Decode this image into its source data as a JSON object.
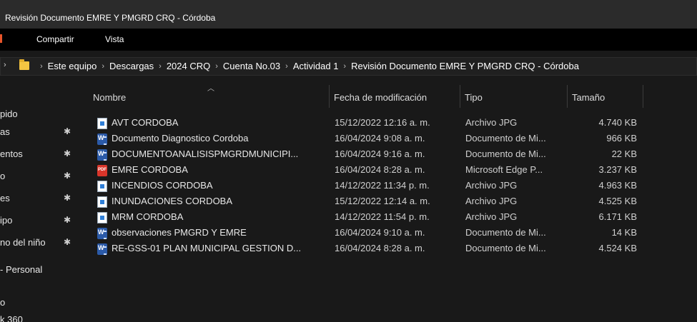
{
  "window": {
    "title": "Revisión Documento EMRE Y PMGRD CRQ - Córdoba"
  },
  "ribbon": {
    "tabs": [
      "Compartir",
      "Vista"
    ]
  },
  "address": {
    "back_glyph": "›",
    "crumbs": [
      "Este equipo",
      "Descargas",
      "2024 CRQ",
      "Cuenta No.03",
      "Actividad 1",
      "Revisión Documento EMRE Y PMGRD CRQ - Córdoba"
    ]
  },
  "nav": {
    "items": [
      {
        "label": "pido",
        "pinned": false
      },
      {
        "label": "as",
        "pinned": true
      },
      {
        "label": "entos",
        "pinned": true
      },
      {
        "label": "o",
        "pinned": true
      },
      {
        "label": "es",
        "pinned": true
      },
      {
        "label": "ipo",
        "pinned": true
      },
      {
        "label": "no del niño",
        "pinned": true
      },
      {
        "label": "- Personal",
        "pinned": false
      },
      {
        "label": "o",
        "pinned": false
      },
      {
        "label": "k 360",
        "pinned": false
      }
    ]
  },
  "columns": {
    "name": "Nombre",
    "date": "Fecha de modificación",
    "type": "Tipo",
    "size": "Tamaño"
  },
  "files": [
    {
      "icon": "jpg-file-icon",
      "name": "AVT CORDOBA",
      "date": "15/12/2022 12:16 a. m.",
      "type": "Archivo JPG",
      "size": "4.740 KB"
    },
    {
      "icon": "word-file-icon",
      "name": "Documento Diagnostico Cordoba",
      "date": "16/04/2024 9:08 a. m.",
      "type": "Documento de Mi...",
      "size": "966 KB"
    },
    {
      "icon": "word-file-icon",
      "name": "DOCUMENTOANALISISPMGRDMUNICIPI...",
      "date": "16/04/2024 9:16 a. m.",
      "type": "Documento de Mi...",
      "size": "22 KB"
    },
    {
      "icon": "pdf-file-icon",
      "name": "EMRE CORDOBA",
      "date": "16/04/2024 8:28 a. m.",
      "type": "Microsoft Edge P...",
      "size": "3.237 KB"
    },
    {
      "icon": "jpg-file-icon",
      "name": "INCENDIOS CORDOBA",
      "date": "14/12/2022 11:34 p. m.",
      "type": "Archivo JPG",
      "size": "4.963 KB"
    },
    {
      "icon": "jpg-file-icon",
      "name": "INUNDACIONES CORDOBA",
      "date": "15/12/2022 12:14 a. m.",
      "type": "Archivo JPG",
      "size": "4.525 KB"
    },
    {
      "icon": "jpg-file-icon",
      "name": "MRM CORDOBA",
      "date": "14/12/2022 11:54 p. m.",
      "type": "Archivo JPG",
      "size": "6.171 KB"
    },
    {
      "icon": "word-file-icon",
      "name": "observaciones PMGRD Y EMRE",
      "date": "16/04/2024 9:10 a. m.",
      "type": "Documento de Mi...",
      "size": "14 KB"
    },
    {
      "icon": "word-file-icon",
      "name": "RE-GSS-01 PLAN MUNICIPAL GESTION D...",
      "date": "16/04/2024 8:28 a. m.",
      "type": "Documento de Mi...",
      "size": "4.524 KB"
    }
  ],
  "colors": {
    "background": "#191919",
    "titlebar": "#2b2b2b",
    "ribbon": "#000000",
    "folder": "#f4c542",
    "word": "#2b5aa8",
    "pdf": "#d9352a",
    "jpg": "#2f7fd8"
  }
}
